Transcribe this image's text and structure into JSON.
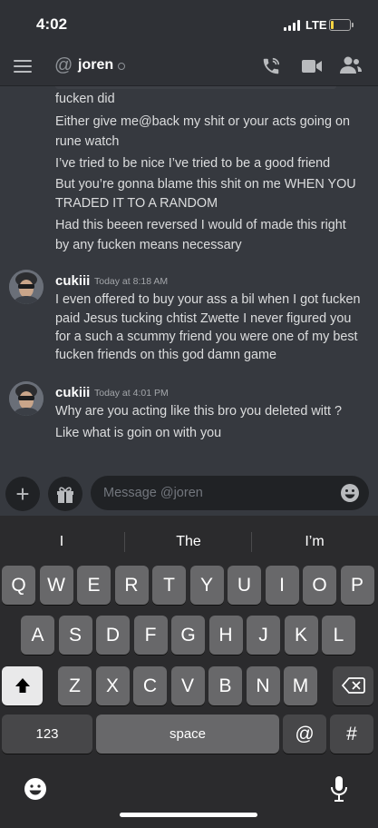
{
  "status_bar": {
    "time": "4:02",
    "network": "LTE",
    "battery_level": 0.18,
    "battery_color": "#f5d442"
  },
  "header": {
    "at_symbol": "@",
    "recipient": "joren",
    "icons": [
      "menu-icon",
      "call-icon",
      "video-icon",
      "members-icon"
    ]
  },
  "messages": {
    "continued_lines": [
      "fucken did",
      "Either give me@back my shit or your acts going on",
      "rune watch",
      "I’ve tried to be nice I’ve tried to be a good friend",
      "But you’re gonna blame this shit on me WHEN YOU",
      "TRADED IT TO A RANDOM",
      "Had this beeen reversed I would of made this right",
      "by any fucken means necessary"
    ],
    "groups": [
      {
        "author": "cukiii",
        "timestamp": "Today at 8:18 AM",
        "lines": [
          "I even offered to buy your ass a bil when I got fucken",
          "paid Jesus tucking chtist Zwette I never figured you",
          "for a such a scummy friend you were one of my best",
          "fucken friends on this god damn game"
        ]
      },
      {
        "author": "cukiii",
        "timestamp": "Today at 4:01 PM",
        "lines": [
          "Why are you acting like this bro you deleted witt ?",
          "Like what is goin on with you"
        ]
      }
    ]
  },
  "composer": {
    "placeholder": "Message @joren",
    "plus": "+"
  },
  "keyboard": {
    "suggestions": [
      "I",
      "The",
      "I’m"
    ],
    "row1": [
      "Q",
      "W",
      "E",
      "R",
      "T",
      "Y",
      "U",
      "I",
      "O",
      "P"
    ],
    "row2": [
      "A",
      "S",
      "D",
      "F",
      "G",
      "H",
      "J",
      "K",
      "L"
    ],
    "row3": [
      "Z",
      "X",
      "C",
      "V",
      "B",
      "N",
      "M"
    ],
    "numbers_label": "123",
    "space_label": "space",
    "at_label": "@",
    "hash_label": "#"
  }
}
